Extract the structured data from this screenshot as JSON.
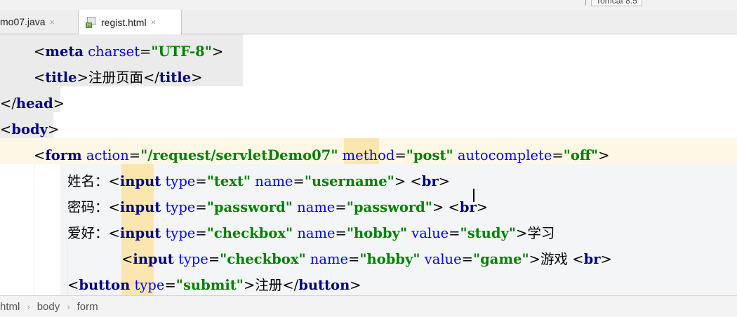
{
  "toolbar": {
    "separator": "|",
    "run_config": "Tomcat 8.5"
  },
  "tabs": [
    {
      "label": "mo07.java",
      "close": "×"
    },
    {
      "label": "regist.html",
      "close": "×",
      "icon": "html-file-icon"
    }
  ],
  "editor": {
    "lines": [
      {
        "open": "<",
        "tag": "meta",
        "parts": [
          {
            "attr": "charset",
            "val": "\"UTF-8\""
          }
        ],
        "close": ">"
      },
      {
        "text": "<title>注册页面</title>"
      },
      {
        "text": "</head>"
      },
      {
        "text": "<body>"
      },
      {
        "text": "<form action=\"/request/servletDemo07\" method=\"post\" autocomplete=\"off\">"
      },
      {
        "text": "姓名：<input type=\"text\" name=\"username\"> <br>"
      },
      {
        "text": "密码：<input type=\"password\" name=\"password\"> <br>"
      },
      {
        "text": "爱好：<input type=\"checkbox\" name=\"hobby\" value=\"study\">学习"
      },
      {
        "text": "<input type=\"checkbox\" name=\"hobby\" value=\"game\">游戏 <br>"
      },
      {
        "text": "<button type=\"submit\">注册</button>"
      }
    ],
    "tokens": {
      "l1_lt": "<",
      "l1_tag": "meta",
      "l1_attr": " charset",
      "l1_eq": "=",
      "l1_val": "\"UTF-8\"",
      "l1_gt": ">",
      "l2_lt": "<",
      "l2_tag": "title",
      "l2_gt": ">",
      "l2_txt": "注册页面",
      "l2_lt2": "</",
      "l2_tag2": "title",
      "l2_gt2": ">",
      "l3_lt": "</",
      "l3_tag": "head",
      "l3_gt": ">",
      "l4_lt": "<",
      "l4_tag": "body",
      "l4_gt": ">",
      "l5_lt": "<",
      "l5_tag": "form",
      "l5_a1": " action",
      "l5_eq1": "=",
      "l5_v1": "\"/request/servletDemo07\"",
      "l5_a2": " method",
      "l5_eq2": "=",
      "l5_v2": "\"post\"",
      "l5_a3": " autocomplete",
      "l5_eq3": "=",
      "l5_v3": "\"off\"",
      "l5_gt": ">",
      "l6_txt": "姓名：",
      "l6_lt": "<",
      "l6_tag": "input",
      "l6_a1": " type",
      "l6_eq1": "=",
      "l6_v1": "\"text\"",
      "l6_a2": " name",
      "l6_eq2": "=",
      "l6_v2": "\"username\"",
      "l6_gt": ">",
      "l6_sp": " ",
      "l6_brlt": "<",
      "l6_br": "br",
      "l6_brgt": ">",
      "l7_txt": "密码：",
      "l7_lt": "<",
      "l7_tag": "input",
      "l7_a1": " type",
      "l7_eq1": "=",
      "l7_v1": "\"password\"",
      "l7_a2": " name",
      "l7_eq2": "=",
      "l7_v2": "\"password\"",
      "l7_gt": ">",
      "l7_sp": " ",
      "l7_brlt": "<",
      "l7_br": "br",
      "l7_brgt": ">",
      "l8_txt": "爱好：",
      "l8_lt": "<",
      "l8_tag": "input",
      "l8_a1": " type",
      "l8_eq1": "=",
      "l8_v1": "\"checkbox\"",
      "l8_a2": " name",
      "l8_eq2": "=",
      "l8_v2": "\"hobby\"",
      "l8_a3": " value",
      "l8_eq3": "=",
      "l8_v3": "\"study\"",
      "l8_gt": ">",
      "l8_txt2": "学习",
      "l9_lt": "<",
      "l9_tag": "input",
      "l9_a1": " type",
      "l9_eq1": "=",
      "l9_v1": "\"checkbox\"",
      "l9_a2": " name",
      "l9_eq2": "=",
      "l9_v2": "\"hobby\"",
      "l9_a3": " value",
      "l9_eq3": "=",
      "l9_v3": "\"game\"",
      "l9_gt": ">",
      "l9_txt": "游戏",
      "l9_sp": " ",
      "l9_brlt": "<",
      "l9_br": "br",
      "l9_brgt": ">",
      "l10_lt": "<",
      "l10_tag": "button",
      "l10_a1": " type",
      "l10_eq1": "=",
      "l10_v1": "\"submit\"",
      "l10_gt": ">",
      "l10_txt": "注册",
      "l10_lt2": "</",
      "l10_tag2": "button",
      "l10_gt2": ">"
    }
  },
  "breadcrumb": {
    "items": [
      "html",
      "body",
      "form"
    ],
    "separator": "›"
  }
}
